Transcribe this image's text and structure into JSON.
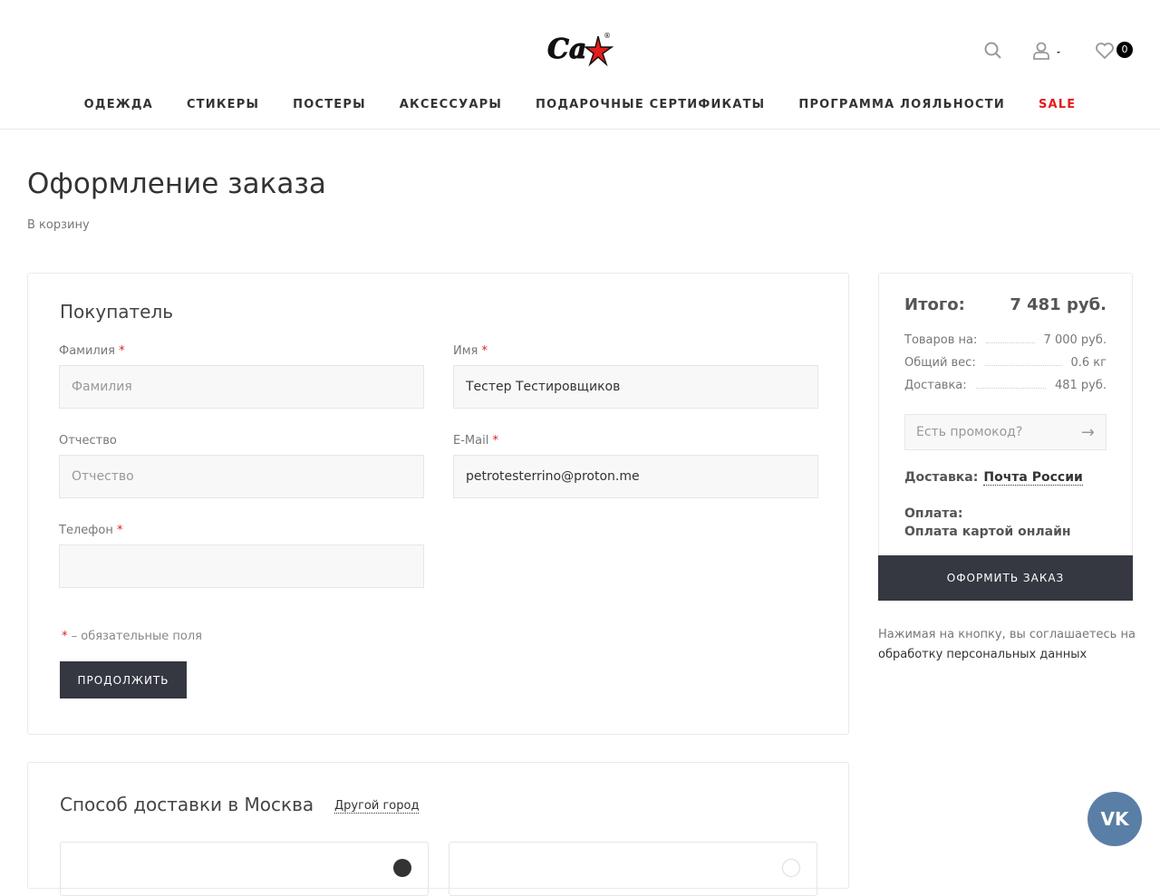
{
  "header": {
    "logo_text": "Ca",
    "wishlist_count": "0",
    "nav": [
      "ОДЕЖДА",
      "СТИКЕРЫ",
      "ПОСТЕРЫ",
      "АКСЕССУАРЫ",
      "ПОДАРОЧНЫЕ СЕРТИФИКАТЫ",
      "ПРОГРАММА ЛОЯЛЬНОСТИ",
      "SALE"
    ]
  },
  "page": {
    "title": "Оформление заказа",
    "back_link": "В корзину"
  },
  "buyer": {
    "title": "Покупатель",
    "fields": [
      {
        "label": "Фамилия",
        "required": "*",
        "value": "",
        "placeholder": "Фамилия"
      },
      {
        "label": "Имя",
        "required": "*",
        "value": "Тестер Тестировщиков",
        "placeholder": ""
      },
      {
        "label": "Отчество",
        "required": "",
        "value": "",
        "placeholder": "Отчество"
      },
      {
        "label": "E-Mail",
        "required": "*",
        "value": "petrotesterrino@proton.me",
        "placeholder": ""
      },
      {
        "label": "Телефон",
        "required": "*",
        "value": "",
        "placeholder": ""
      }
    ],
    "required_star": "*",
    "required_note": " – обязательные поля",
    "continue": "ПРОДОЛЖИТЬ"
  },
  "summary": {
    "total_label": "Итого:",
    "total": "7 481 руб.",
    "rows": [
      {
        "label": "Товаров на:",
        "value": "7 000 руб."
      },
      {
        "label": "Общий вес:",
        "value": "0.6 кг"
      },
      {
        "label": "Доставка:",
        "value": "481 руб."
      }
    ],
    "promo_placeholder": "Есть промокод?",
    "delivery_label": "Доставка:",
    "delivery_value": "Почта России",
    "payment_label": "Оплата:",
    "payment_value": "Оплата картой онлайн",
    "order_button": "ОФОРМИТЬ ЗАКАЗ"
  },
  "note": {
    "text": "Нажимая на кнопку, вы соглашаетесь на ",
    "link": "обработку персональных данных"
  },
  "delivery": {
    "title": "Способ доставки в Москва",
    "other_city": "Другой город"
  },
  "vk": "VK"
}
